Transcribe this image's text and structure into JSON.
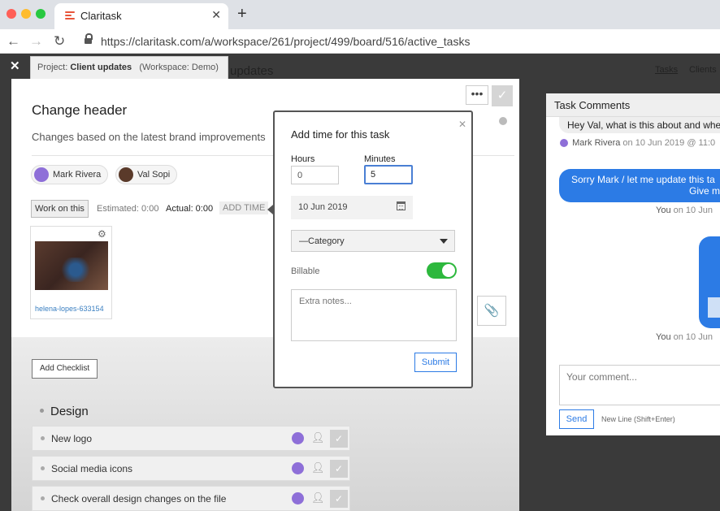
{
  "browser": {
    "tab_title": "Claritask",
    "url": "https://claritask.com/a/workspace/261/project/499/board/516/active_tasks"
  },
  "app": {
    "project_label": "Project:",
    "project_name": "Client updates",
    "workspace_label": "(Workspace: Demo)",
    "bg_title": "updates",
    "nav_tasks": "Tasks",
    "nav_clients": "Clients"
  },
  "task": {
    "title": "Change header",
    "description": "Changes based on the latest brand improvements",
    "more_glyph": "•••",
    "assignees": [
      "Mark Rivera",
      "Val Sopi"
    ],
    "work_button": "Work on this",
    "estimated": "Estimated: 0:00",
    "actual": "Actual: 0:00",
    "add_time": "ADD TIME",
    "attachment_name": "helena-lopes-633154",
    "add_checklist": "Add Checklist",
    "checklist_section": "Design",
    "checklist_items": [
      "New logo",
      "Social media icons",
      "Check overall design changes on the file"
    ]
  },
  "popup": {
    "title": "Add time for this task",
    "hours_label": "Hours",
    "minutes_label": "Minutes",
    "hours_value": "0",
    "minutes_value": "5",
    "date": "10 Jun 2019",
    "category": "—Category",
    "billable_label": "Billable",
    "billable_on": true,
    "notes_placeholder": "Extra notes...",
    "submit": "Submit"
  },
  "comments": {
    "header": "Task Comments",
    "c1_text": "Hey Val, what is this about and whe",
    "c1_author": "Mark Rivera",
    "c1_date": "on 10 Jun 2019 @ 11:0",
    "c2_line1": "Sorry Mark / let me update this ta",
    "c2_line2": "Give m",
    "c2_author": "You",
    "c2_date": "on 10 Jun",
    "c3_author": "You",
    "c3_date": "on 10 Jun",
    "input_placeholder": "Your comment...",
    "send": "Send",
    "newline_hint": "New Line (Shift+Enter)"
  },
  "colors": {
    "accent_blue": "#2c7be5",
    "toggle_green": "#2db83d",
    "avatar_purple": "#8e6fd8"
  }
}
